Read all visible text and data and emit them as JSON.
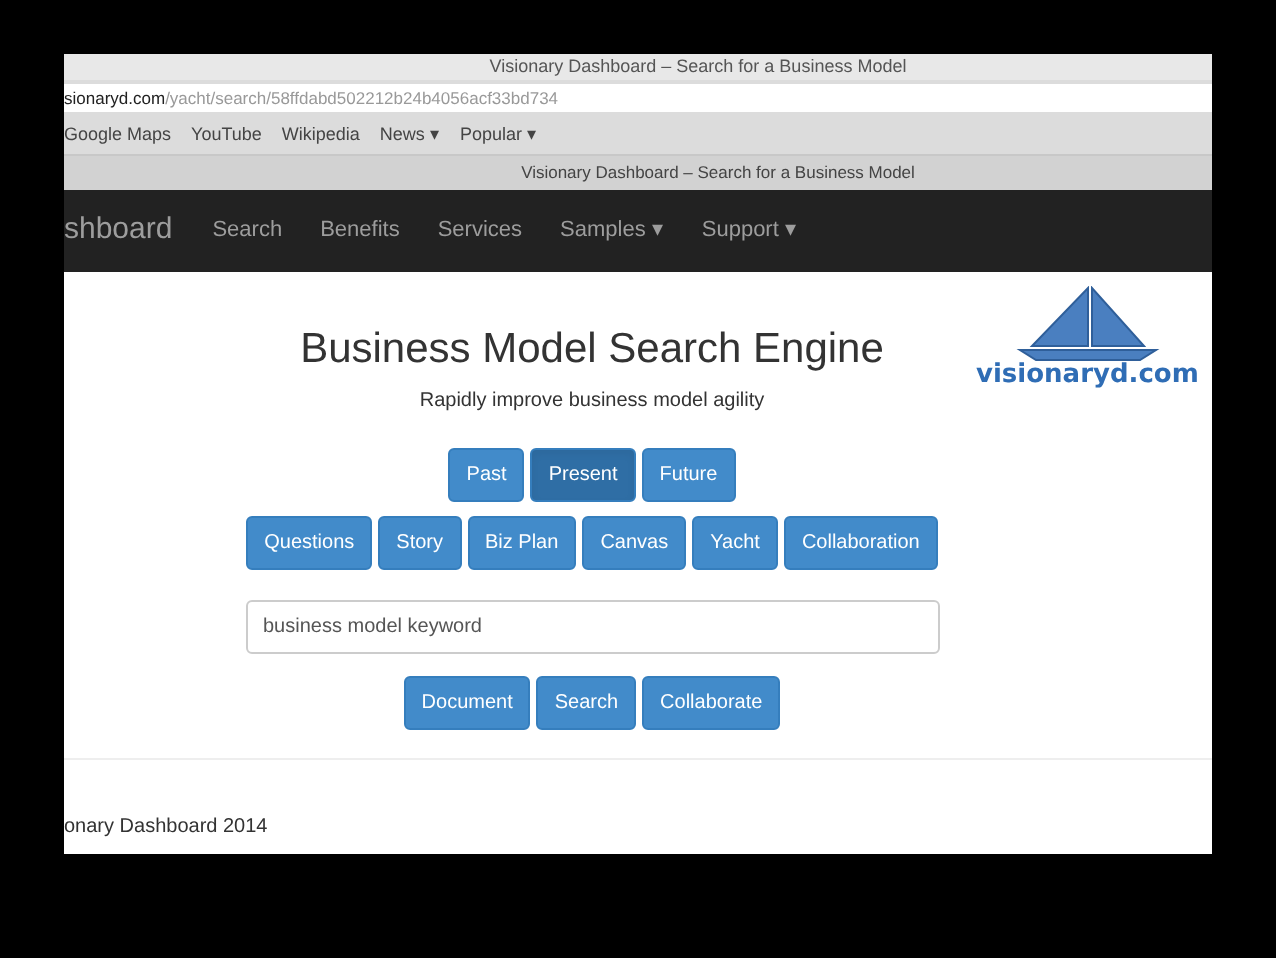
{
  "window": {
    "title": "Visionary Dashboard – Search for a Business Model"
  },
  "address_bar": {
    "domain": "sionaryd.com",
    "path": "/yacht/search/58ffdabd502212b24b4056acf33bd734"
  },
  "bookmarks": [
    {
      "label": "Google Maps"
    },
    {
      "label": "YouTube"
    },
    {
      "label": "Wikipedia"
    },
    {
      "label": "News ▾"
    },
    {
      "label": "Popular ▾"
    }
  ],
  "tab": {
    "title": "Visionary Dashboard – Search for a Business Model"
  },
  "navbar": {
    "brand": "shboard",
    "items": [
      {
        "label": "Search"
      },
      {
        "label": "Benefits"
      },
      {
        "label": "Services"
      },
      {
        "label": "Samples ▾"
      },
      {
        "label": "Support ▾"
      }
    ]
  },
  "logo": {
    "text": "visionaryd.com"
  },
  "heading": "Business Model Search Engine",
  "subheading": "Rapidly improve business model agility",
  "time_buttons": [
    {
      "label": "Past",
      "selected": false
    },
    {
      "label": "Present",
      "selected": true
    },
    {
      "label": "Future",
      "selected": false
    }
  ],
  "section_buttons": [
    {
      "label": "Questions"
    },
    {
      "label": "Story"
    },
    {
      "label": "Biz Plan"
    },
    {
      "label": "Canvas"
    },
    {
      "label": "Yacht"
    },
    {
      "label": "Collaboration"
    }
  ],
  "search": {
    "placeholder": "business model keyword"
  },
  "action_buttons": [
    {
      "label": "Document"
    },
    {
      "label": "Search"
    },
    {
      "label": "Collaborate"
    }
  ],
  "footer": "onary Dashboard 2014"
}
